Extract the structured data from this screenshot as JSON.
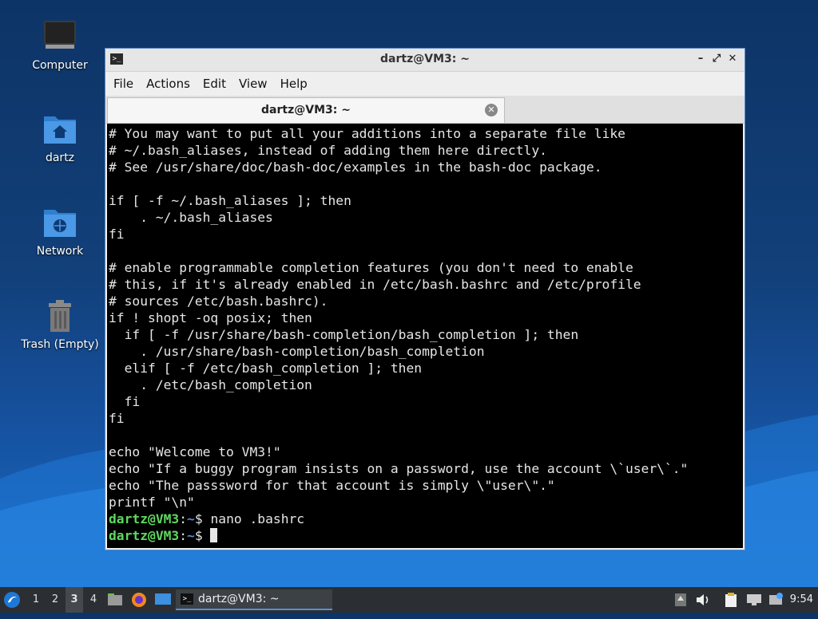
{
  "desktop": {
    "icons": [
      {
        "label": "Computer",
        "icon": "computer-icon"
      },
      {
        "label": "dartz",
        "icon": "home-folder-icon"
      },
      {
        "label": "Network",
        "icon": "network-folder-icon"
      },
      {
        "label": "Trash (Empty)",
        "icon": "trash-icon"
      }
    ]
  },
  "window": {
    "title": "dartz@VM3: ~",
    "buttons": {
      "minimize": "–",
      "maximize": "⤢",
      "close": "✕"
    },
    "menu": [
      "File",
      "Actions",
      "Edit",
      "View",
      "Help"
    ],
    "tab": {
      "label": "dartz@VM3: ~",
      "close": "✕"
    }
  },
  "terminal": {
    "lines": [
      "# You may want to put all your additions into a separate file like",
      "# ~/.bash_aliases, instead of adding them here directly.",
      "# See /usr/share/doc/bash-doc/examples in the bash-doc package.",
      "",
      "if [ -f ~/.bash_aliases ]; then",
      "    . ~/.bash_aliases",
      "fi",
      "",
      "# enable programmable completion features (you don't need to enable",
      "# this, if it's already enabled in /etc/bash.bashrc and /etc/profile",
      "# sources /etc/bash.bashrc).",
      "if ! shopt -oq posix; then",
      "  if [ -f /usr/share/bash-completion/bash_completion ]; then",
      "    . /usr/share/bash-completion/bash_completion",
      "  elif [ -f /etc/bash_completion ]; then",
      "    . /etc/bash_completion",
      "  fi",
      "fi",
      "",
      "echo \"Welcome to VM3!\"",
      "echo \"If a buggy program insists on a password, use the account \\`user\\`.\"",
      "echo \"The passsword for that account is simply \\\"user\\\".\"",
      "printf \"\\n\""
    ],
    "prompt_user": "dartz@VM3",
    "prompt_sep": ":",
    "prompt_path": "~",
    "prompt_symbol": "$ ",
    "command": "nano .bashrc"
  },
  "taskbar": {
    "workspaces": [
      "1",
      "2",
      "3",
      "4"
    ],
    "active_workspace": "3",
    "task_label": "dartz@VM3: ~",
    "clock": "9:54"
  },
  "colors": {
    "prompt_user": "#5fd75f",
    "prompt_path": "#5f87d7",
    "taskbar": "#2b2f33"
  }
}
